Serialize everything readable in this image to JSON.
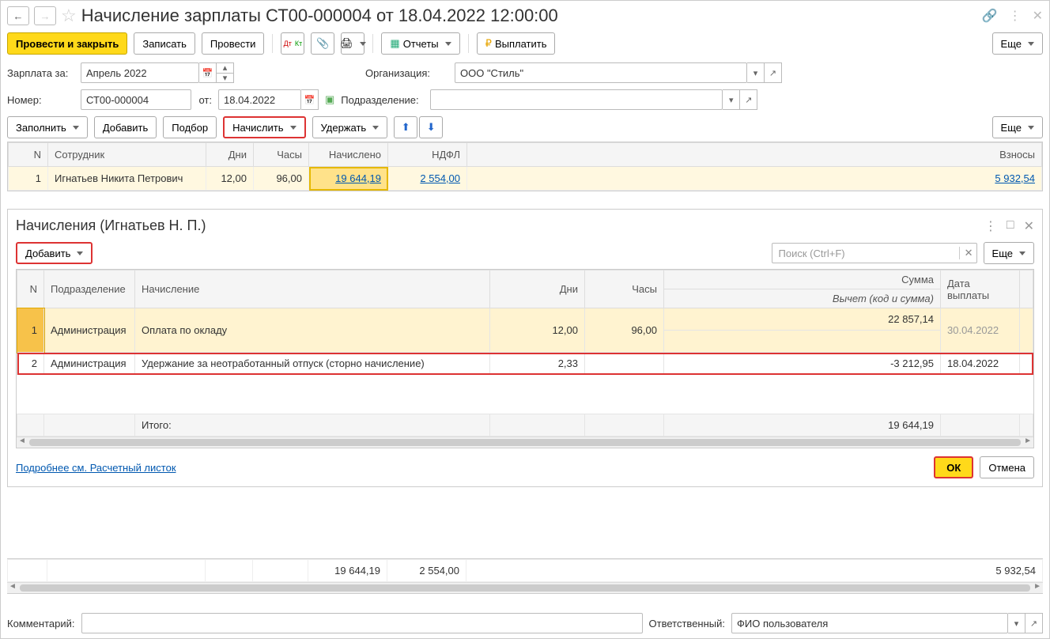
{
  "title": "Начисление зарплаты СТ00-000004 от 18.04.2022 12:00:00",
  "toolbar": {
    "post_and_close": "Провести и закрыть",
    "save": "Записать",
    "post": "Провести",
    "reports": "Отчеты",
    "pay": "Выплатить",
    "more": "Еще"
  },
  "form": {
    "salary_for_label": "Зарплата за:",
    "salary_for_value": "Апрель 2022",
    "org_label": "Организация:",
    "org_value": "ООО \"Стиль\"",
    "number_label": "Номер:",
    "number_value": "СТ00-000004",
    "date_label": "от:",
    "date_value": "18.04.2022",
    "dept_label": "Подразделение:",
    "dept_value": ""
  },
  "toolbar2": {
    "fill": "Заполнить",
    "add": "Добавить",
    "pick": "Подбор",
    "accrue": "Начислить",
    "withhold": "Удержать",
    "more": "Еще"
  },
  "main_table": {
    "headers": {
      "n": "N",
      "employee": "Сотрудник",
      "days": "Дни",
      "hours": "Часы",
      "accrued": "Начислено",
      "ndfl": "НДФЛ",
      "contrib": "Взносы"
    },
    "row": {
      "n": "1",
      "employee": "Игнатьев Никита Петрович",
      "days": "12,00",
      "hours": "96,00",
      "accrued": "19 644,19",
      "ndfl": "2 554,00",
      "contrib": "5 932,54"
    }
  },
  "panel": {
    "title": "Начисления (Игнатьев Н. П.)",
    "add": "Добавить",
    "search_placeholder": "Поиск (Ctrl+F)",
    "more": "Еще",
    "headers": {
      "n": "N",
      "dept": "Подразделение",
      "accrual": "Начисление",
      "days": "Дни",
      "hours": "Часы",
      "sum": "Сумма",
      "pay_date": "Дата выплаты",
      "deduction": "Вычет (код и сумма)"
    },
    "rows": [
      {
        "n": "1",
        "dept": "Администрация",
        "accrual": "Оплата по окладу",
        "days": "12,00",
        "hours": "96,00",
        "sum": "22 857,14",
        "pay_date": "30.04.2022"
      },
      {
        "n": "2",
        "dept": "Администрация",
        "accrual": "Удержание за неотработанный отпуск (сторно начисление)",
        "days": "2,33",
        "hours": "",
        "sum": "-3 212,95",
        "pay_date": "18.04.2022"
      }
    ],
    "total_label": "Итого:",
    "total_sum": "19 644,19",
    "link": "Подробнее см. Расчетный листок",
    "ok": "ОК",
    "cancel": "Отмена"
  },
  "bottom_totals": {
    "accrued": "19 644,19",
    "ndfl": "2 554,00",
    "contrib": "5 932,54"
  },
  "statusbar": {
    "comment_label": "Комментарий:",
    "responsible_label": "Ответственный:",
    "responsible_value": "ФИО пользователя"
  }
}
